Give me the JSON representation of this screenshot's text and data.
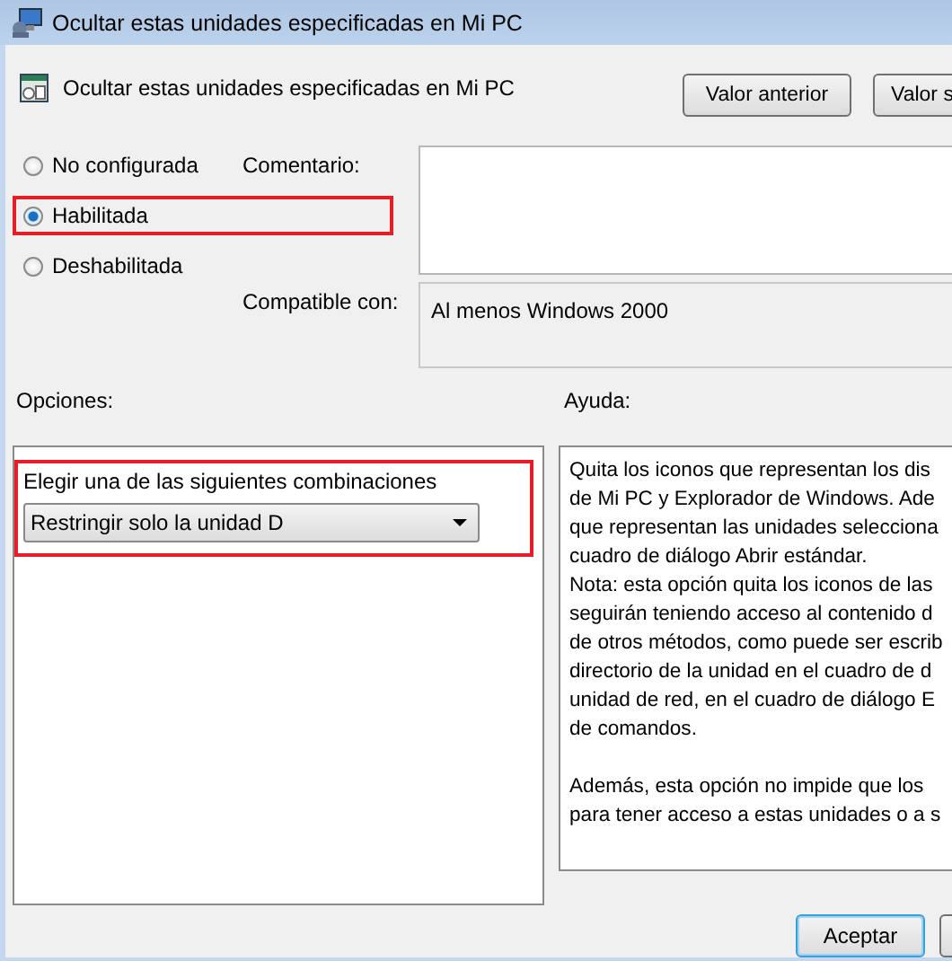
{
  "window": {
    "title": "Ocultar estas unidades especificadas en Mi PC"
  },
  "header": {
    "title": "Ocultar estas unidades especificadas en Mi PC",
    "buttons": [
      "Valor anterior",
      "Valor s"
    ]
  },
  "state_options": [
    {
      "label": "No configurada",
      "selected": false,
      "highlighted": false
    },
    {
      "label": "Habilitada",
      "selected": true,
      "highlighted": true
    },
    {
      "label": "Deshabilitada",
      "selected": false,
      "highlighted": false
    }
  ],
  "comment": {
    "label": "Comentario:"
  },
  "supported": {
    "label": "Compatible con:",
    "value": "Al menos Windows 2000"
  },
  "options": {
    "label": "Opciones:",
    "highlighted": true,
    "prompt": "Elegir una de las siguientes combinaciones",
    "dropdown": "Restringir solo la unidad D"
  },
  "help": {
    "label": "Ayuda:",
    "paragraphs": [
      [
        "Quita los iconos que representan los dis",
        "de Mi PC y Explorador de Windows. Ade",
        "que representan las unidades selecciona",
        "cuadro de diálogo Abrir estándar.",
        "Nota: esta opción quita los iconos de las",
        "seguirán teniendo acceso al contenido d",
        "de otros métodos, como puede ser escrib",
        "directorio de la unidad en el cuadro de d",
        "unidad de red, en el cuadro de diálogo E",
        "de comandos."
      ],
      [
        "Además, esta opción no impide que los",
        "para tener acceso a estas unidades o a s"
      ]
    ]
  },
  "footer": {
    "buttons": [
      {
        "label": "Aceptar",
        "kind": "default"
      },
      {
        "kind": "plain"
      }
    ]
  }
}
